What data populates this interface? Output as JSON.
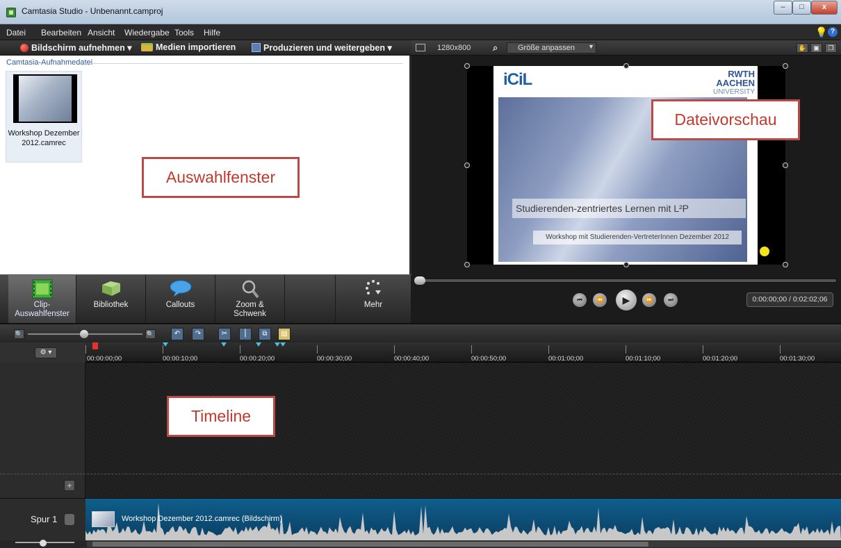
{
  "window": {
    "title": "Camtasia Studio - Unbenannt.camproj",
    "controls": {
      "minimize": "–",
      "maximize": "□",
      "close": "x"
    }
  },
  "menu": [
    "Datei",
    "Bearbeiten",
    "Ansicht",
    "Wiedergabe",
    "Tools",
    "Hilfe"
  ],
  "toolbar": {
    "record": "Bildschirm aufnehmen ▾",
    "import": "Medien importieren",
    "produce": "Produzieren und weitergeben ▾"
  },
  "clip_bin": {
    "section_label": "Camtasia-Aufnahmedatei",
    "clip_name_line1": "Workshop Dezember",
    "clip_name_line2": "2012.camrec"
  },
  "annotations": {
    "selection": "Auswahlfenster",
    "preview": "Dateivorschau",
    "timeline": "Timeline"
  },
  "tabs": [
    {
      "line1": "Clip-",
      "line2": "Auswahlfenster",
      "icon": "filmstrip-icon",
      "active": true
    },
    {
      "line1": "Bibliothek",
      "line2": "",
      "icon": "library-icon",
      "active": false
    },
    {
      "line1": "Callouts",
      "line2": "",
      "icon": "speech-bubble-icon",
      "active": false
    },
    {
      "line1": "Zoom &",
      "line2": "Schwenk",
      "icon": "magnifier-icon",
      "active": false
    },
    {
      "line1": "Mehr",
      "line2": "",
      "icon": "more-dots-icon",
      "active": false
    }
  ],
  "preview": {
    "resolution": "1280x800",
    "fit_option": "Größe anpassen",
    "timecode": "0:00:00;00 / 0:02:02;06",
    "slide": {
      "logo_left": "iCiL",
      "logo_right_line1": "RWTH AACHEN",
      "logo_right_line2": "UNIVERSITY",
      "title": "Studierenden-zentriertes Lernen mit L²P",
      "subtitle": "Workshop mit Studierenden-VertreterInnen Dezember 2012"
    },
    "playback": {
      "position_fraction": 0.0
    }
  },
  "timeline": {
    "ruler": [
      "00:00:00;00",
      "00:00:10;00",
      "00:00:20;00",
      "00:00:30;00",
      "00:00:40;00",
      "00:00:50;00",
      "00:01:00;00",
      "00:01:10;00",
      "00:01:20;00",
      "00:01:30;00"
    ],
    "track_name": "Spur 1",
    "clip_label": "Workshop Dezember 2012.camrec (Bildschirm)"
  },
  "colors": {
    "annotation_border": "#b94a45",
    "annotation_text": "#c0392b",
    "track_clip": "#0f5e8c",
    "waveform": "#c8c8c8"
  }
}
